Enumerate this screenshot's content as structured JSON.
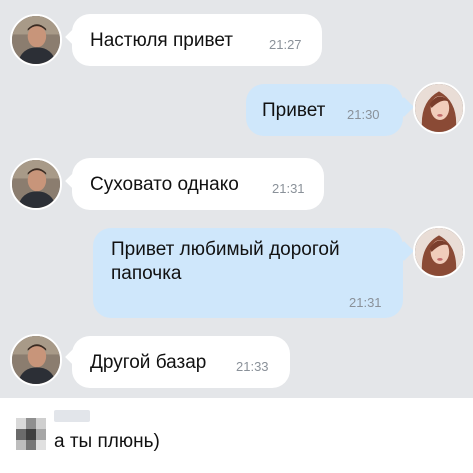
{
  "messages": [
    {
      "direction": "incoming",
      "text": "Настюля привет",
      "time": "21:27"
    },
    {
      "direction": "outgoing",
      "text": "Привет",
      "time": "21:30"
    },
    {
      "direction": "incoming",
      "text": "Суховато однако",
      "time": "21:31"
    },
    {
      "direction": "outgoing",
      "lines": [
        "Привет любимый дорогой",
        "папочка"
      ],
      "time": "21:31"
    },
    {
      "direction": "incoming",
      "text": "Другой базар",
      "time": "21:33"
    }
  ],
  "comment": {
    "text": "а ты плюнь)"
  },
  "colors": {
    "chat_background": "#e4e6e9",
    "incoming_bubble": "#ffffff",
    "outgoing_bubble": "#cfe7fb",
    "time_text": "#8a9199"
  }
}
